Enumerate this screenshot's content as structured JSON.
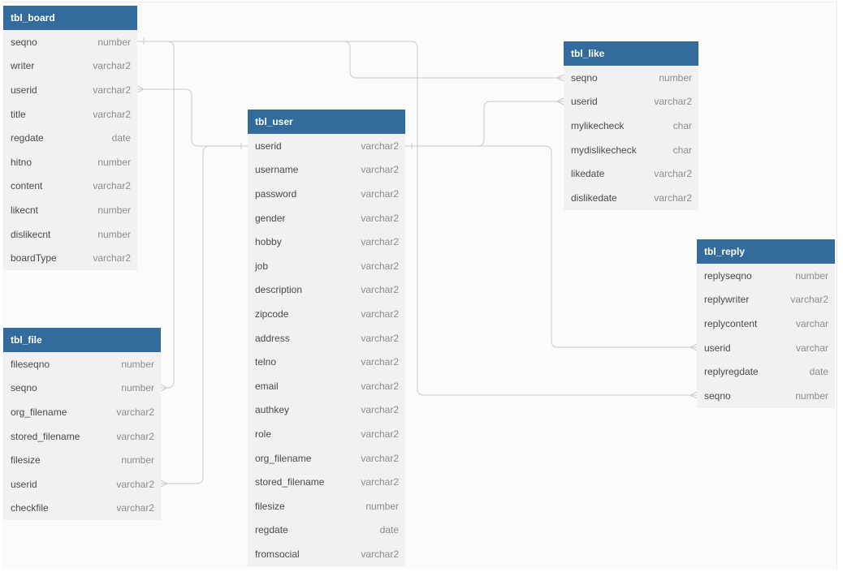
{
  "tables": [
    {
      "id": "board",
      "name": "tbl_board",
      "columns": [
        {
          "name": "seqno",
          "type": "number"
        },
        {
          "name": "writer",
          "type": "varchar2"
        },
        {
          "name": "userid",
          "type": "varchar2"
        },
        {
          "name": "title",
          "type": "varchar2"
        },
        {
          "name": "regdate",
          "type": "date"
        },
        {
          "name": "hitno",
          "type": "number"
        },
        {
          "name": "content",
          "type": "varchar2"
        },
        {
          "name": "likecnt",
          "type": "number"
        },
        {
          "name": "dislikecnt",
          "type": "number"
        },
        {
          "name": "boardType",
          "type": "varchar2"
        }
      ]
    },
    {
      "id": "file",
      "name": "tbl_file",
      "columns": [
        {
          "name": "fileseqno",
          "type": "number"
        },
        {
          "name": "seqno",
          "type": "number"
        },
        {
          "name": "org_filename",
          "type": "varchar2"
        },
        {
          "name": "stored_filename",
          "type": "varchar2"
        },
        {
          "name": "filesize",
          "type": "number"
        },
        {
          "name": "userid",
          "type": "varchar2"
        },
        {
          "name": "checkfile",
          "type": "varchar2"
        }
      ]
    },
    {
      "id": "user",
      "name": "tbl_user",
      "columns": [
        {
          "name": "userid",
          "type": "varchar2"
        },
        {
          "name": "username",
          "type": "varchar2"
        },
        {
          "name": "password",
          "type": "varchar2"
        },
        {
          "name": "gender",
          "type": "varchar2"
        },
        {
          "name": "hobby",
          "type": "varchar2"
        },
        {
          "name": "job",
          "type": "varchar2"
        },
        {
          "name": "description",
          "type": "varchar2"
        },
        {
          "name": "zipcode",
          "type": "varchar2"
        },
        {
          "name": "address",
          "type": "varchar2"
        },
        {
          "name": "telno",
          "type": "varchar2"
        },
        {
          "name": "email",
          "type": "varchar2"
        },
        {
          "name": "authkey",
          "type": "varchar2"
        },
        {
          "name": "role",
          "type": "varchar2"
        },
        {
          "name": "org_filename",
          "type": "varchar2"
        },
        {
          "name": "stored_filename",
          "type": "varchar2"
        },
        {
          "name": "filesize",
          "type": "number"
        },
        {
          "name": "regdate",
          "type": "date"
        },
        {
          "name": "fromsocial",
          "type": "varchar2"
        }
      ]
    },
    {
      "id": "like",
      "name": "tbl_like",
      "columns": [
        {
          "name": "seqno",
          "type": "number"
        },
        {
          "name": "userid",
          "type": "varchar2"
        },
        {
          "name": "mylikecheck",
          "type": "char"
        },
        {
          "name": "mydislikecheck",
          "type": "char"
        },
        {
          "name": "likedate",
          "type": "varchar2"
        },
        {
          "name": "dislikedate",
          "type": "varchar2"
        }
      ]
    },
    {
      "id": "reply",
      "name": "tbl_reply",
      "columns": [
        {
          "name": "replyseqno",
          "type": "number"
        },
        {
          "name": "replywriter",
          "type": "varchar2"
        },
        {
          "name": "replycontent",
          "type": "varchar"
        },
        {
          "name": "userid",
          "type": "varchar"
        },
        {
          "name": "replyregdate",
          "type": "date"
        },
        {
          "name": "seqno",
          "type": "number"
        }
      ]
    }
  ],
  "relationships": [
    {
      "from": "tbl_board.seqno",
      "to": "tbl_file.seqno"
    },
    {
      "from": "tbl_board.seqno",
      "to": "tbl_like.seqno"
    },
    {
      "from": "tbl_board.seqno",
      "to": "tbl_reply.seqno"
    },
    {
      "from": "tbl_user.userid",
      "to": "tbl_board.userid"
    },
    {
      "from": "tbl_user.userid",
      "to": "tbl_file.userid"
    },
    {
      "from": "tbl_user.userid",
      "to": "tbl_like.userid"
    },
    {
      "from": "tbl_user.userid",
      "to": "tbl_reply.userid"
    }
  ],
  "colors": {
    "header": "#336b9c",
    "header_text": "#ffffff",
    "body": "#f1f1f1",
    "column_text": "#4a4a4a",
    "type_text": "#8c8c8c",
    "link": "#c9c9c9"
  }
}
